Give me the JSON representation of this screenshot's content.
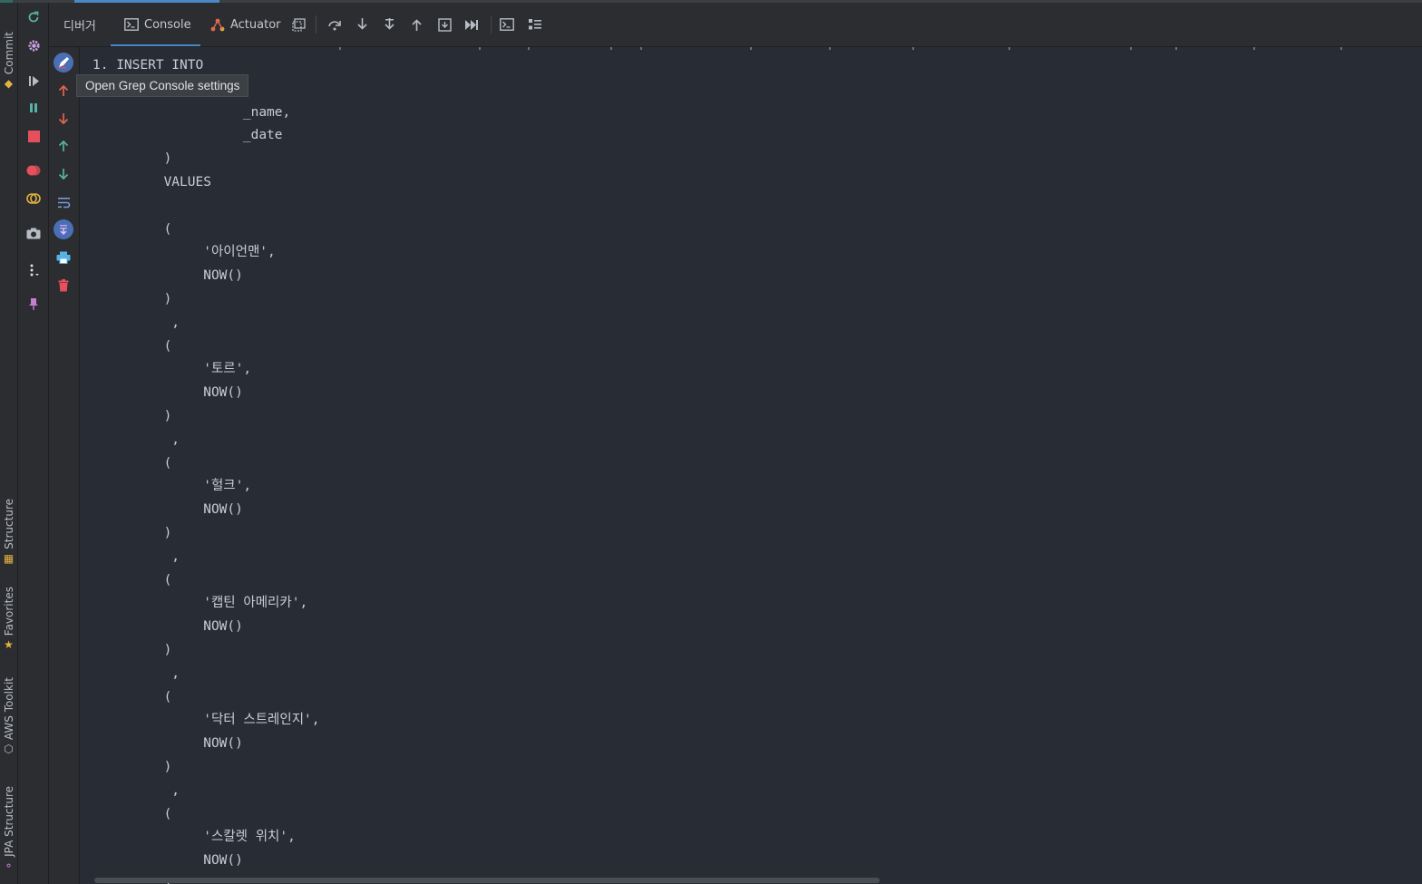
{
  "tool_windows": {
    "commit": "Commit",
    "structure": "Structure",
    "favorites": "Favorites",
    "aws_toolkit": "AWS Toolkit",
    "jpa_structure": "JPA Structure"
  },
  "tabs": {
    "debugger": "디버거",
    "console": "Console",
    "actuator": "Actuator"
  },
  "tooltip": "Open Grep Console settings",
  "console_lines": [
    "1. INSERT INTO",
    "",
    "                   _name,",
    "                   _date",
    "         )",
    "         VALUES",
    "",
    "         (",
    "              '아이언맨',",
    "              NOW()",
    "         )",
    "          ,",
    "         (",
    "              '토르',",
    "              NOW()",
    "         )",
    "          ,",
    "         (",
    "              '헐크',",
    "              NOW()",
    "         )",
    "          ,",
    "         (",
    "              '캡틴 아메리카',",
    "              NOW()",
    "         )",
    "          ,",
    "         (",
    "              '닥터 스트레인지',",
    "              NOW()",
    "         )",
    "          ,",
    "         (",
    "              '스칼렛 위치',",
    "              NOW()",
    "         )"
  ],
  "colors": {
    "accent": "#4a88c7",
    "stop": "#e5505c",
    "arrow_up_red": "#e0664f",
    "arrow_green": "#55b3a5",
    "console_bg": "#282c34"
  }
}
